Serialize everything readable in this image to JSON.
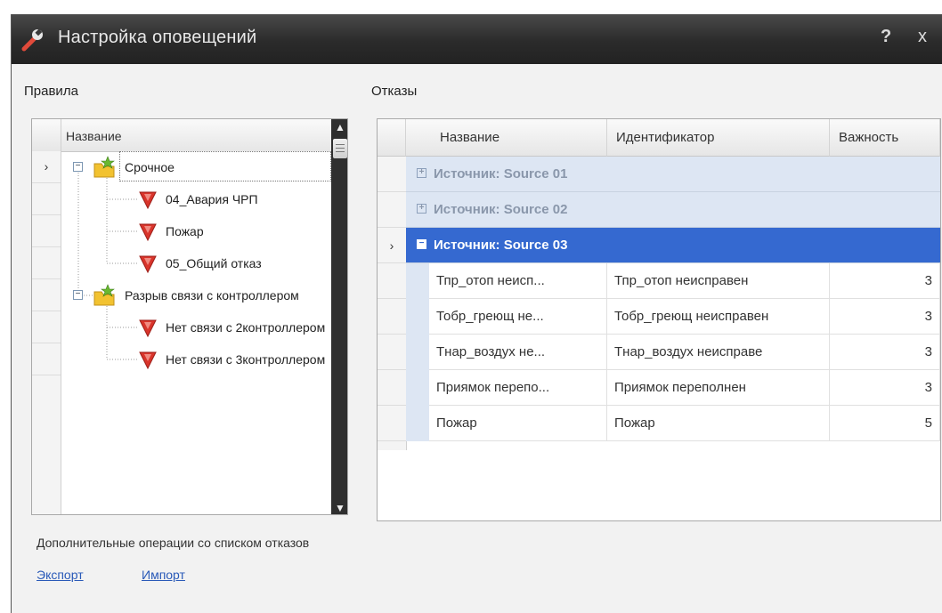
{
  "window": {
    "title": "Настройка оповещений",
    "help_glyph": "?",
    "close_glyph": "x"
  },
  "rules": {
    "label": "Правила",
    "column_header": "Название",
    "current_row_glyph": "›",
    "nodes": [
      {
        "level": 0,
        "text": "Срочное",
        "icon": "folder-star-icon",
        "expanded": true
      },
      {
        "level": 1,
        "text": "04_Авария ЧРП",
        "icon": "alert-marker-icon"
      },
      {
        "level": 1,
        "text": "Пожар",
        "icon": "alert-marker-icon"
      },
      {
        "level": 1,
        "text": "05_Общий отказ",
        "icon": "alert-marker-icon"
      },
      {
        "level": 0,
        "text": "Разрыв связи с контроллером",
        "icon": "folder-star-icon",
        "expanded": true
      },
      {
        "level": 1,
        "text": "Нет связи с 2контроллером",
        "icon": "alert-marker-icon"
      },
      {
        "level": 1,
        "text": "Нет связи с 3контроллером",
        "icon": "alert-marker-icon"
      }
    ]
  },
  "faults": {
    "label": "Отказы",
    "columns": [
      "Название",
      "Идентификатор",
      "Важность"
    ],
    "current_row_glyph": "›",
    "groups": [
      {
        "label": "Источник: Source 01",
        "expanded": false
      },
      {
        "label": "Источник: Source 02",
        "expanded": false
      },
      {
        "label": "Источник: Source 03",
        "expanded": true
      }
    ],
    "rows": [
      {
        "name": "Тпр_отоп неисп...",
        "id": "Тпр_отоп неисправен",
        "importance": "3"
      },
      {
        "name": "Тобр_греющ не...",
        "id": "Тобр_греющ неисправен",
        "importance": "3"
      },
      {
        "name": "Тнар_воздух не...",
        "id": "Тнар_воздух неисправе",
        "importance": "3"
      },
      {
        "name": "Приямок перепо...",
        "id": "Приямок переполнен",
        "importance": "3"
      },
      {
        "name": "Пожар",
        "id": "Пожар",
        "importance": "5"
      }
    ]
  },
  "operations": {
    "label": "Дополнительные операции со списком отказов",
    "export_label": "Экспорт",
    "import_label": "Импорт"
  },
  "colors": {
    "titlebar": "#2b2b2b",
    "selection": "#3569d0",
    "group_row": "#dde6f3",
    "link": "#2a5ab8",
    "alert_icon": "#d9342b"
  }
}
